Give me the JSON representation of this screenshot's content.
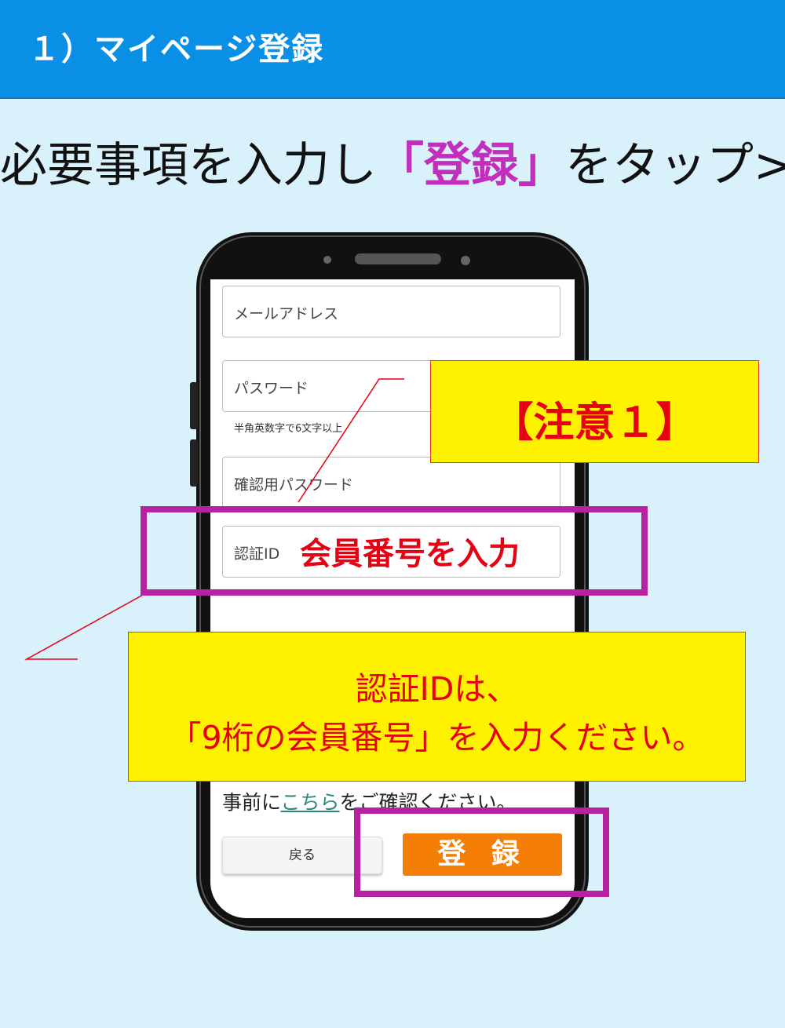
{
  "header": {
    "title": "１）マイページ登録"
  },
  "headline": {
    "before": "必要事項を入力し",
    "accent": "「登録」",
    "after": "をタップ>"
  },
  "form": {
    "email_label": "メールアドレス",
    "password_label": "パスワード",
    "password_hint": "半角英数字で6文字以上",
    "confirm_label": "確認用パスワード",
    "auth_label": "認証ID",
    "auth_value_note": "会員番号を入力",
    "pre_note_before": "事前に",
    "pre_note_link": "こちら",
    "pre_note_after": "をご確認ください。",
    "back_label": "戻る",
    "register_label": "登 録"
  },
  "callouts": {
    "caution": "【注意１】",
    "line1": "認証IDは、",
    "line2": "「9桁の会員番号」を入力ください。"
  },
  "colors": {
    "header_bg": "#0a8fe6",
    "page_bg": "#d9f1fb",
    "accent_magenta": "#c22fbd",
    "highlight_box": "#b8219f",
    "callout_yellow": "#fff200",
    "callout_red": "#e60012",
    "register_orange": "#f57e06",
    "link_green": "#2a8a7a"
  }
}
